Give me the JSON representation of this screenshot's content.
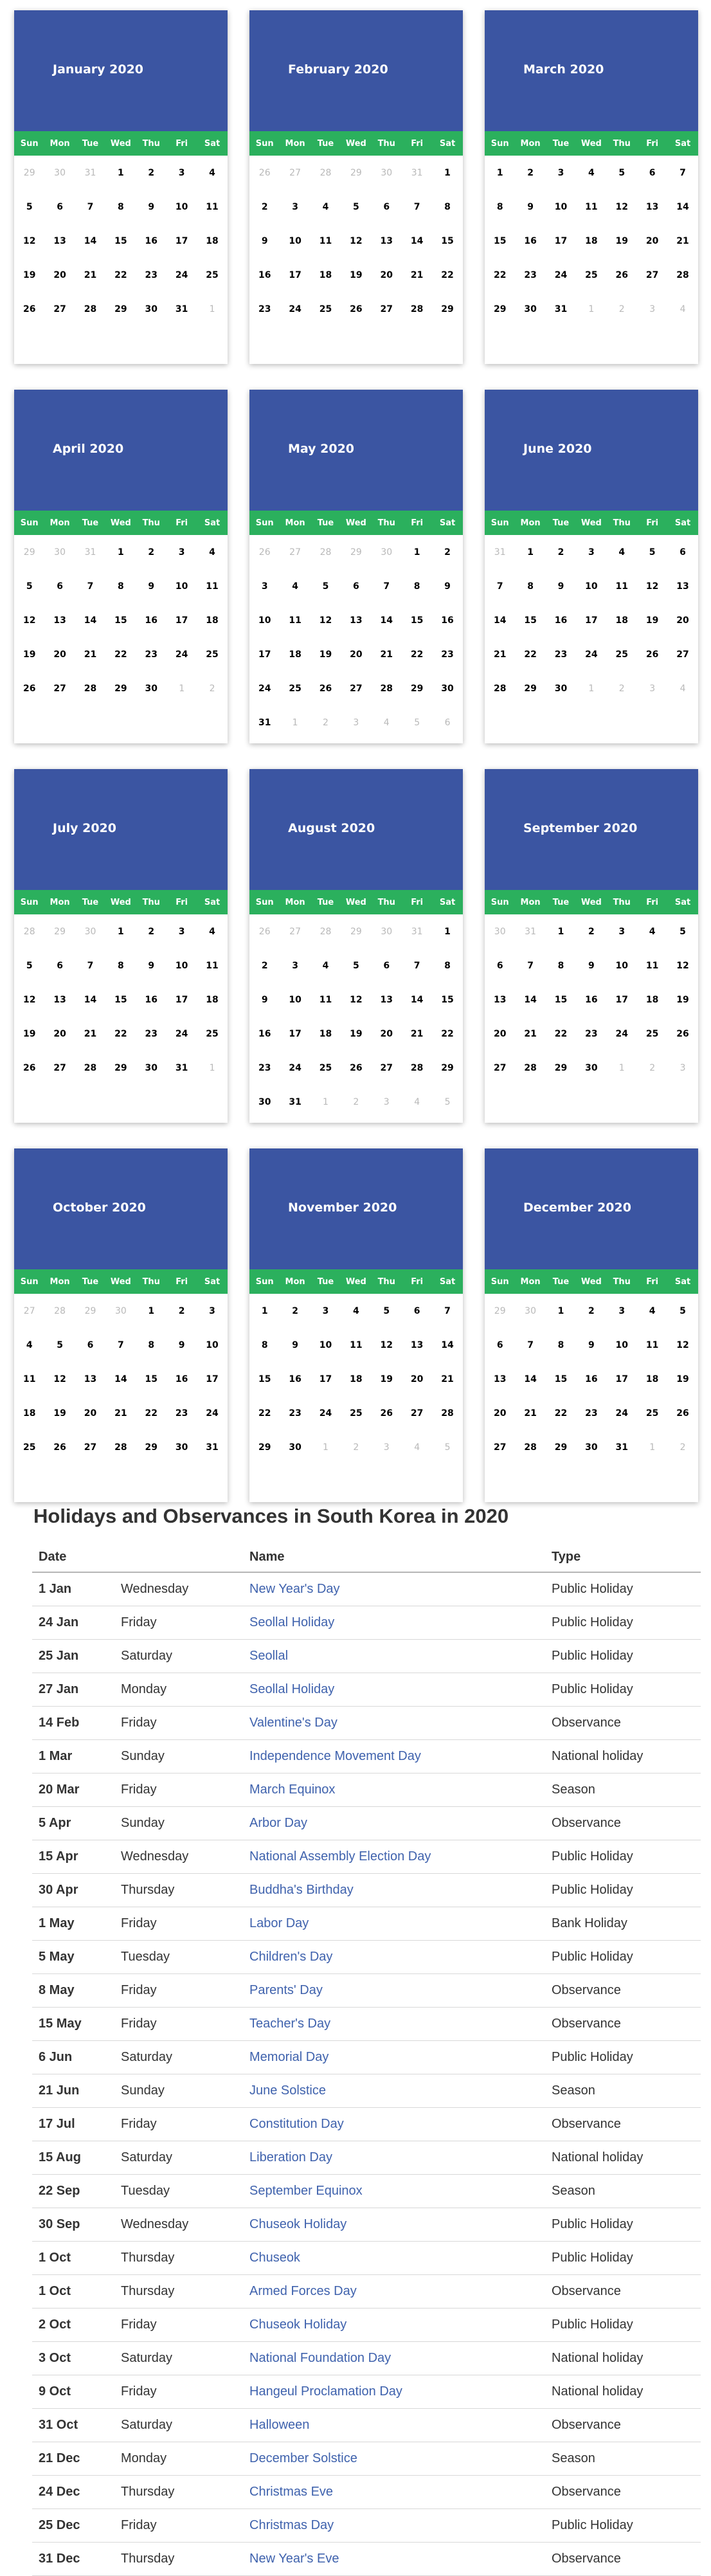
{
  "colors": {
    "month_header": "#3b55a2",
    "dow_bar": "#2bb05d",
    "link": "#3f62ad"
  },
  "weekday_labels": [
    "Sun",
    "Mon",
    "Tue",
    "Wed",
    "Thu",
    "Fri",
    "Sat"
  ],
  "months": [
    {
      "title": "January 2020",
      "lead": [
        29,
        30,
        31
      ],
      "days": 31,
      "trail": [
        1
      ]
    },
    {
      "title": "February 2020",
      "lead": [
        26,
        27,
        28,
        29,
        30,
        31
      ],
      "days": 29,
      "trail": []
    },
    {
      "title": "March 2020",
      "lead": [],
      "days": 31,
      "trail": [
        1,
        2,
        3,
        4
      ]
    },
    {
      "title": "April 2020",
      "lead": [
        29,
        30,
        31
      ],
      "days": 30,
      "trail": [
        1,
        2
      ]
    },
    {
      "title": "May 2020",
      "lead": [
        26,
        27,
        28,
        29,
        30
      ],
      "days": 31,
      "trail": [
        1,
        2,
        3,
        4,
        5,
        6
      ]
    },
    {
      "title": "June 2020",
      "lead": [
        31
      ],
      "days": 30,
      "trail": [
        1,
        2,
        3,
        4
      ]
    },
    {
      "title": "July 2020",
      "lead": [
        28,
        29,
        30
      ],
      "days": 31,
      "trail": [
        1
      ]
    },
    {
      "title": "August 2020",
      "lead": [
        26,
        27,
        28,
        29,
        30,
        31
      ],
      "days": 31,
      "trail": [
        1,
        2,
        3,
        4,
        5
      ]
    },
    {
      "title": "September 2020",
      "lead": [
        30,
        31
      ],
      "days": 30,
      "trail": [
        1,
        2,
        3
      ]
    },
    {
      "title": "October 2020",
      "lead": [
        27,
        28,
        29,
        30
      ],
      "days": 31,
      "trail": []
    },
    {
      "title": "November 2020",
      "lead": [],
      "days": 30,
      "trail": [
        1,
        2,
        3,
        4,
        5
      ]
    },
    {
      "title": "December 2020",
      "lead": [
        29,
        30
      ],
      "days": 31,
      "trail": [
        1,
        2
      ]
    }
  ],
  "holidays": {
    "title": "Holidays and Observances in South Korea in 2020",
    "columns": [
      "Date",
      "",
      "Name",
      "Type"
    ],
    "rows": [
      {
        "date": "1 Jan",
        "weekday": "Wednesday",
        "name": "New Year's Day",
        "type": "Public Holiday"
      },
      {
        "date": "24 Jan",
        "weekday": "Friday",
        "name": "Seollal Holiday",
        "type": "Public Holiday"
      },
      {
        "date": "25 Jan",
        "weekday": "Saturday",
        "name": "Seollal",
        "type": "Public Holiday"
      },
      {
        "date": "27 Jan",
        "weekday": "Monday",
        "name": "Seollal Holiday",
        "type": "Public Holiday"
      },
      {
        "date": "14 Feb",
        "weekday": "Friday",
        "name": "Valentine's Day",
        "type": "Observance"
      },
      {
        "date": "1 Mar",
        "weekday": "Sunday",
        "name": "Independence Movement Day",
        "type": "National holiday"
      },
      {
        "date": "20 Mar",
        "weekday": "Friday",
        "name": "March Equinox",
        "type": "Season"
      },
      {
        "date": "5 Apr",
        "weekday": "Sunday",
        "name": "Arbor Day",
        "type": "Observance"
      },
      {
        "date": "15 Apr",
        "weekday": "Wednesday",
        "name": "National Assembly Election Day",
        "type": "Public Holiday"
      },
      {
        "date": "30 Apr",
        "weekday": "Thursday",
        "name": "Buddha's Birthday",
        "type": "Public Holiday"
      },
      {
        "date": "1 May",
        "weekday": "Friday",
        "name": "Labor Day",
        "type": "Bank Holiday"
      },
      {
        "date": "5 May",
        "weekday": "Tuesday",
        "name": "Children's Day",
        "type": "Public Holiday"
      },
      {
        "date": "8 May",
        "weekday": "Friday",
        "name": "Parents' Day",
        "type": "Observance"
      },
      {
        "date": "15 May",
        "weekday": "Friday",
        "name": "Teacher's Day",
        "type": "Observance"
      },
      {
        "date": "6 Jun",
        "weekday": "Saturday",
        "name": "Memorial Day",
        "type": "Public Holiday"
      },
      {
        "date": "21 Jun",
        "weekday": "Sunday",
        "name": "June Solstice",
        "type": "Season"
      },
      {
        "date": "17 Jul",
        "weekday": "Friday",
        "name": "Constitution Day",
        "type": "Observance"
      },
      {
        "date": "15 Aug",
        "weekday": "Saturday",
        "name": "Liberation Day",
        "type": "National holiday"
      },
      {
        "date": "22 Sep",
        "weekday": "Tuesday",
        "name": "September Equinox",
        "type": "Season"
      },
      {
        "date": "30 Sep",
        "weekday": "Wednesday",
        "name": "Chuseok Holiday",
        "type": "Public Holiday"
      },
      {
        "date": "1 Oct",
        "weekday": "Thursday",
        "name": "Chuseok",
        "type": "Public Holiday"
      },
      {
        "date": "1 Oct",
        "weekday": "Thursday",
        "name": "Armed Forces Day",
        "type": "Observance"
      },
      {
        "date": "2 Oct",
        "weekday": "Friday",
        "name": "Chuseok Holiday",
        "type": "Public Holiday"
      },
      {
        "date": "3 Oct",
        "weekday": "Saturday",
        "name": "National Foundation Day",
        "type": "National holiday"
      },
      {
        "date": "9 Oct",
        "weekday": "Friday",
        "name": "Hangeul Proclamation Day",
        "type": "National holiday"
      },
      {
        "date": "31 Oct",
        "weekday": "Saturday",
        "name": "Halloween",
        "type": "Observance"
      },
      {
        "date": "21 Dec",
        "weekday": "Monday",
        "name": "December Solstice",
        "type": "Season"
      },
      {
        "date": "24 Dec",
        "weekday": "Thursday",
        "name": "Christmas Eve",
        "type": "Observance"
      },
      {
        "date": "25 Dec",
        "weekday": "Friday",
        "name": "Christmas Day",
        "type": "Public Holiday"
      },
      {
        "date": "31 Dec",
        "weekday": "Thursday",
        "name": "New Year's Eve",
        "type": "Observance"
      }
    ]
  }
}
